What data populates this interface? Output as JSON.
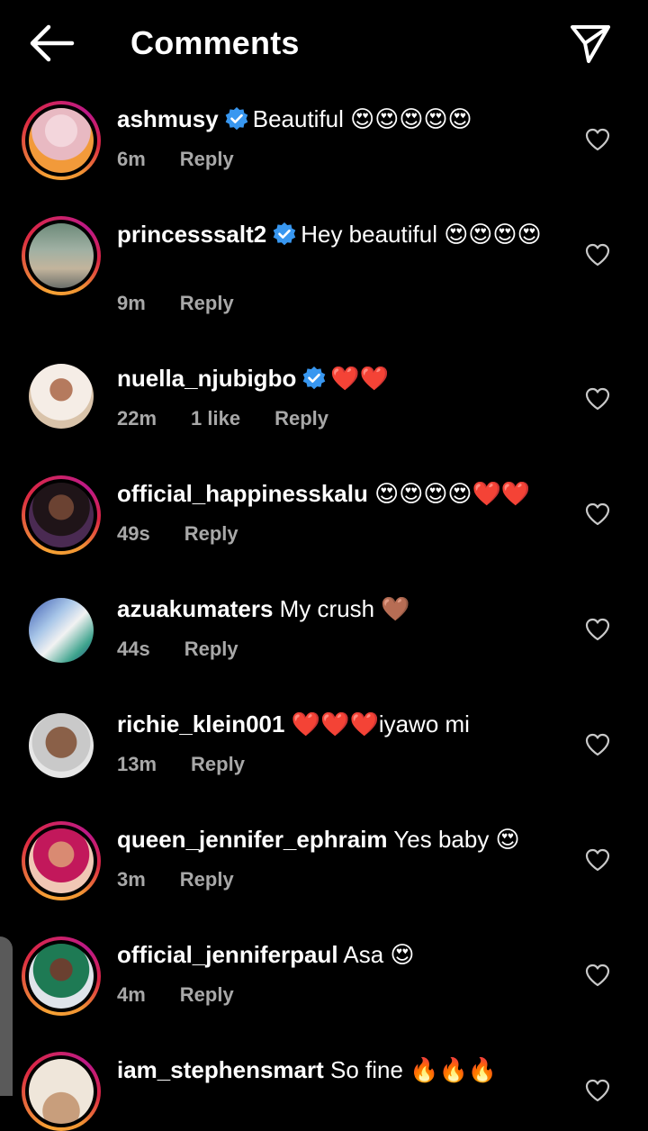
{
  "header": {
    "title": "Comments"
  },
  "comments": [
    {
      "username": "ashmusy",
      "verified": true,
      "text": "Beautiful 😍😍😍😍😍",
      "time": "6m",
      "likes": "",
      "reply": "Reply",
      "avatar": "pink-hair",
      "ring": true
    },
    {
      "username": "princesssalt2",
      "verified": true,
      "text": "Hey beautiful 😍😍😍😍",
      "time": "9m",
      "likes": "",
      "reply": "Reply",
      "avatar": "street",
      "ring": true
    },
    {
      "username": "nuella_njubigbo",
      "verified": true,
      "text": "❤️❤️",
      "time": "22m",
      "likes": "1 like",
      "reply": "Reply",
      "avatar": "white-dress",
      "ring": false
    },
    {
      "username": "official_happinesskalu",
      "verified": false,
      "text": "😍😍😍😍❤️❤️",
      "time": "49s",
      "likes": "",
      "reply": "Reply",
      "avatar": "portrait-purple",
      "ring": true
    },
    {
      "username": "azuakumaters",
      "verified": false,
      "text": "My crush 🤎",
      "time": "44s",
      "likes": "",
      "reply": "Reply",
      "avatar": "abstract-blue",
      "ring": false
    },
    {
      "username": "richie_klein001",
      "verified": false,
      "text": "❤️❤️❤️iyawo mi",
      "time": "13m",
      "likes": "",
      "reply": "Reply",
      "avatar": "man-face",
      "ring": false
    },
    {
      "username": "queen_jennifer_ephraim",
      "verified": false,
      "text": "Yes baby 😍",
      "time": "3m",
      "likes": "",
      "reply": "Reply",
      "avatar": "pink-outfit",
      "ring": true
    },
    {
      "username": "official_jenniferpaul",
      "verified": false,
      "text": "Asa 😍",
      "time": "4m",
      "likes": "",
      "reply": "Reply",
      "avatar": "green-outfit",
      "ring": true
    },
    {
      "username": "iam_stephensmart",
      "verified": false,
      "text": "So fine 🔥🔥🔥",
      "time": "",
      "likes": "",
      "reply": "",
      "avatar": "partial",
      "ring": true
    }
  ],
  "colors": {
    "background": "#000000",
    "meta_text": "#a8a8a8",
    "verified_badge": "#3897f0"
  },
  "icons": {
    "back": "arrow-left-icon",
    "share": "paper-plane-icon",
    "like": "heart-outline-icon",
    "verified": "verified-badge-icon"
  }
}
